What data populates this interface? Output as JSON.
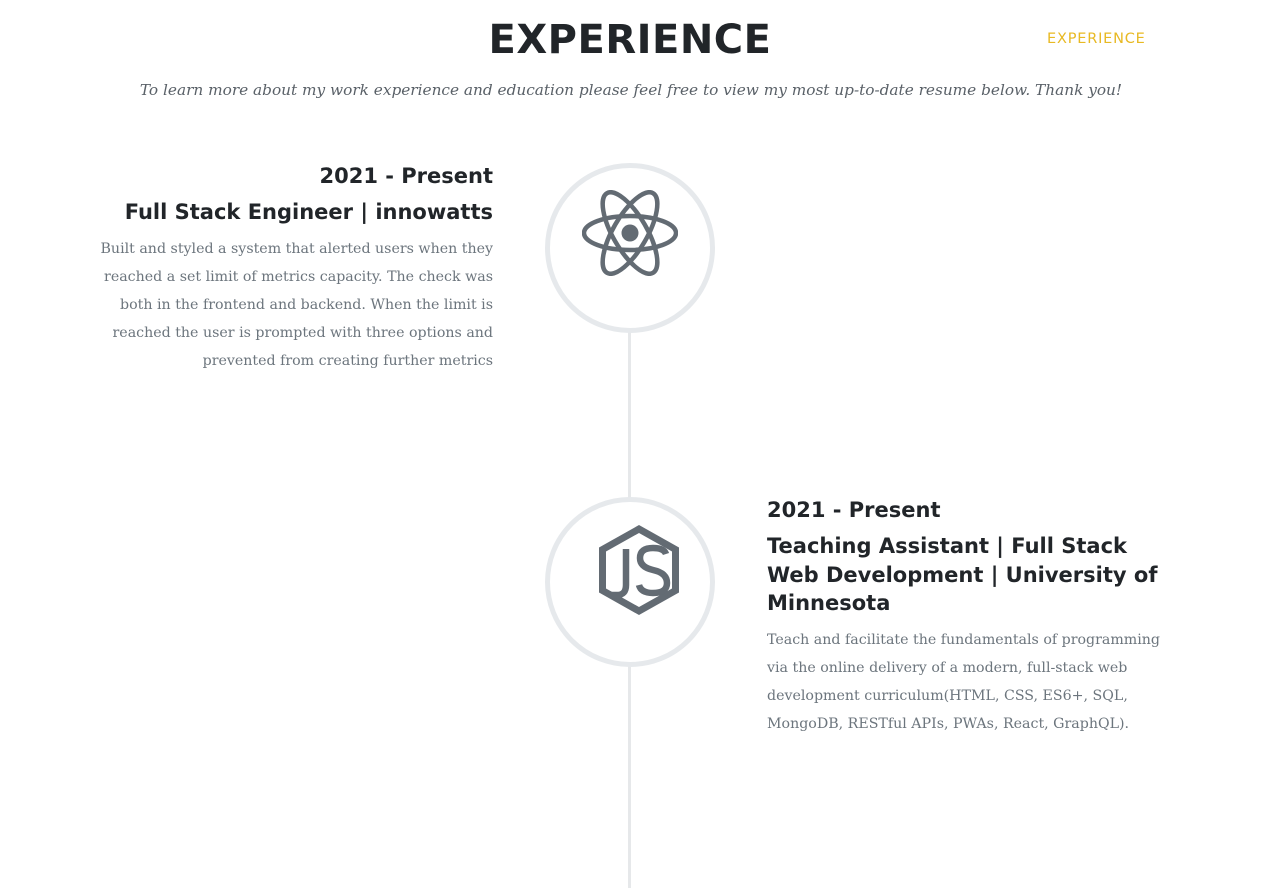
{
  "header": {
    "title": "EXPERIENCE",
    "nav_link": "EXPERIENCE",
    "subtitle": "To learn more about my work experience and education please feel free to view my most up-to-date resume below. Thank you!"
  },
  "colors": {
    "accent": "#e8b923",
    "heading": "#212529",
    "body_text": "#6c757d",
    "icon": "#636b73",
    "timeline": "#e6e9ec"
  },
  "timeline": [
    {
      "icon": "react-icon",
      "date": "2021 - Present",
      "role": "Full Stack Engineer | innowatts",
      "description": "Built and styled a system that alerted users when they reached a set limit of metrics capacity. The check was both in the frontend and backend. When the limit is reached the user is prompted with three options and prevented from creating further metrics"
    },
    {
      "icon": "nodejs-icon",
      "date": "2021 - Present",
      "role": "Teaching Assistant | Full Stack Web Development | University of Minnesota",
      "description": "Teach and facilitate the fundamentals of programming via the online delivery of a modern, full-stack web development curriculum(HTML, CSS, ES6+, SQL, MongoDB, RESTful APIs, PWAs, React, GraphQL)."
    }
  ]
}
